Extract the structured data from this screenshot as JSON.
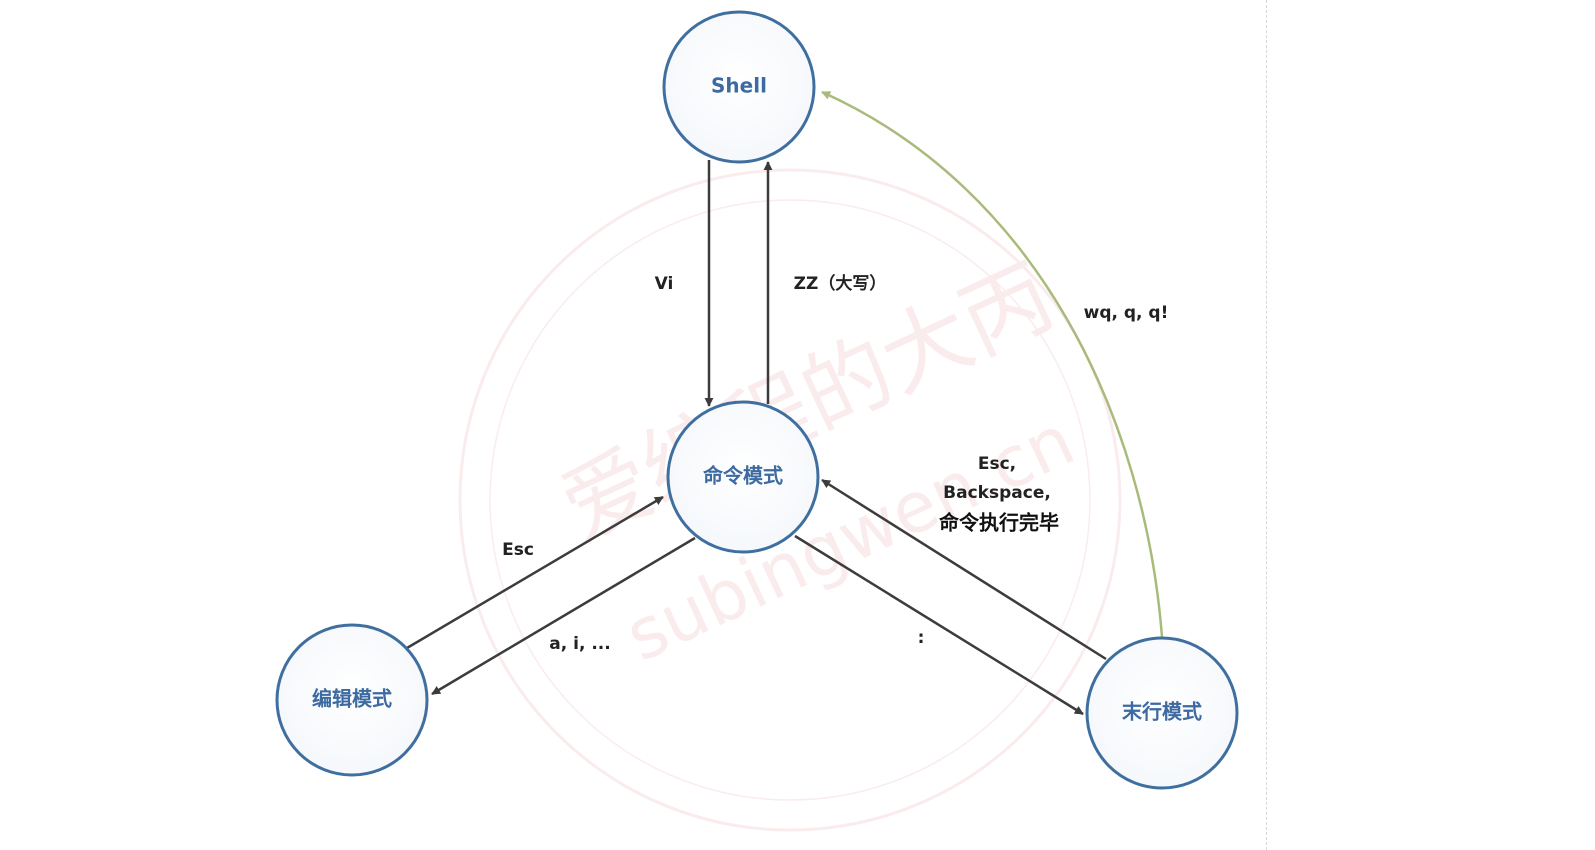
{
  "nodes": {
    "shell": "Shell",
    "command": "命令模式",
    "edit": "编辑模式",
    "lastline": "末行模式"
  },
  "edges": {
    "vi": "Vi",
    "zz": "ZZ（大写）",
    "esc_edit": "Esc",
    "insert": "a, i, ...",
    "colon": ":",
    "back_line1": "Esc,",
    "back_line2": "Backspace,",
    "back_line3": "命令执行完毕",
    "quit": "wq, q, q!"
  },
  "watermark": {
    "cn": "爱编程的大丙",
    "domain": "subingwen.cn"
  },
  "colors": {
    "node_stroke": "#3f6f9f",
    "node_text": "#3d6aa0",
    "edge": "#3c3c3c",
    "quit_edge": "#a9bb7b",
    "watermark": "#f2c9c9"
  }
}
